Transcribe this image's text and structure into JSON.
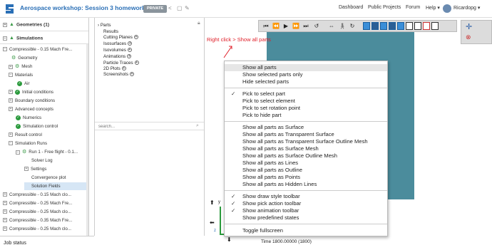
{
  "header": {
    "title": "Aerospace workshop: Session 3 homework",
    "badge": "PRIVATE",
    "nav": [
      "Dashboard",
      "Public Projects",
      "Forum",
      "Help ▾",
      "Ricardopg ▾"
    ]
  },
  "tree": {
    "geometries": "Geometries (1)",
    "simulations": "Simulations",
    "items": [
      "Compressible - 0.15 Mach Fre...",
      "Geometry",
      "Mesh",
      "Materials",
      "Air",
      "Initial conditions",
      "Boundary conditions",
      "Advanced concepts",
      "Numerics",
      "Simulation control",
      "Result control",
      "Simulation Runs",
      "Run 1 - Free flight - 0.1...",
      "Solver Log",
      "Settings",
      "Convergence plot",
      "Solution Fields",
      "Compressible - 0.15 Mach clo...",
      "Compressible - 0.25 Mach Fre...",
      "Compressible - 0.25 Mach clo...",
      "Compressible - 0.35 Mach Fre...",
      "Compressible - 0.25 Mach clo..."
    ]
  },
  "job_status": "Job status",
  "mid": {
    "items": [
      "Parts",
      "Results",
      "Cutting Planes",
      "Isosurfaces",
      "Isovolumes",
      "Animations",
      "Particle Traces",
      "2D Plots",
      "Screenshots"
    ],
    "search_placeholder": "search..."
  },
  "viewer": {
    "annotation": "Right click > Show all parts",
    "time": "Time 1800.00000 (1800)",
    "axis_y": "y",
    "axis_z": "z",
    "model_color": "#4b8c9c"
  },
  "context_menu": {
    "group1": [
      "Show all parts",
      "Show selected parts only",
      "Hide selected parts"
    ],
    "group2": [
      "Pick to select part",
      "Pick to select element",
      "Pick to set rotation point",
      "Pick to hide part"
    ],
    "group3": [
      "Show all parts as Surface",
      "Show all parts as Transparent Surface",
      "Show all parts as Transparent Surface Outline Mesh",
      "Show all parts as Surface Mesh",
      "Show all parts as Surface Outline Mesh",
      "Show all parts as Lines",
      "Show all parts as Outline",
      "Show all parts as Points",
      "Show all parts as Hidden Lines"
    ],
    "group4": [
      "Show draw style toolbar",
      "Show pick action toolbar",
      "Show animation toolbar",
      "Show predefined states"
    ],
    "group5": [
      "Toggle fullscreen"
    ]
  }
}
